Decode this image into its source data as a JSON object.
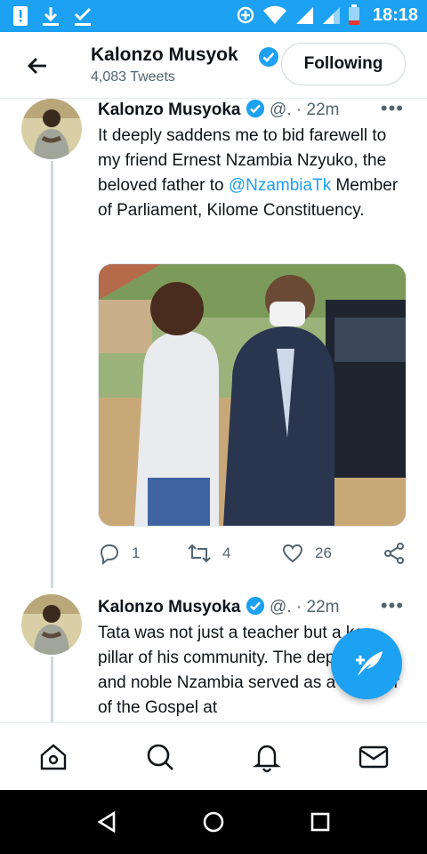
{
  "status_bar": {
    "time": "18:18",
    "icons": [
      "alert-icon",
      "download-icon",
      "check-icon",
      "data-saver-icon",
      "wifi-icon",
      "signal-icon",
      "signal-icon",
      "battery-low-icon"
    ]
  },
  "header": {
    "name": "Kalonzo Musyok",
    "tweet_count": "4,083 Tweets",
    "follow_label": "Following"
  },
  "tweets": [
    {
      "author": "Kalonzo Musyoka",
      "handle": "@.",
      "separator": "·",
      "time": "22m",
      "text_before": "It deeply saddens me to bid farewell to my friend Ernest Nzambia Nzyuko, the beloved father to ",
      "mention": "@NzambiaTk",
      "text_after": " Member of Parliament, Kilome Constituency.",
      "replies": "1",
      "retweets": "4",
      "likes": "26"
    },
    {
      "author": "Kalonzo Musyoka",
      "handle": "@.",
      "separator": "·",
      "time": "22m",
      "text": "Tata was not just a teacher but a key pillar of his community. The dependable and noble Nzambia served as a minister of the Gospel at"
    }
  ],
  "colors": {
    "accent": "#1DA1F2",
    "text": "#0f1419",
    "secondary": "#536471"
  }
}
